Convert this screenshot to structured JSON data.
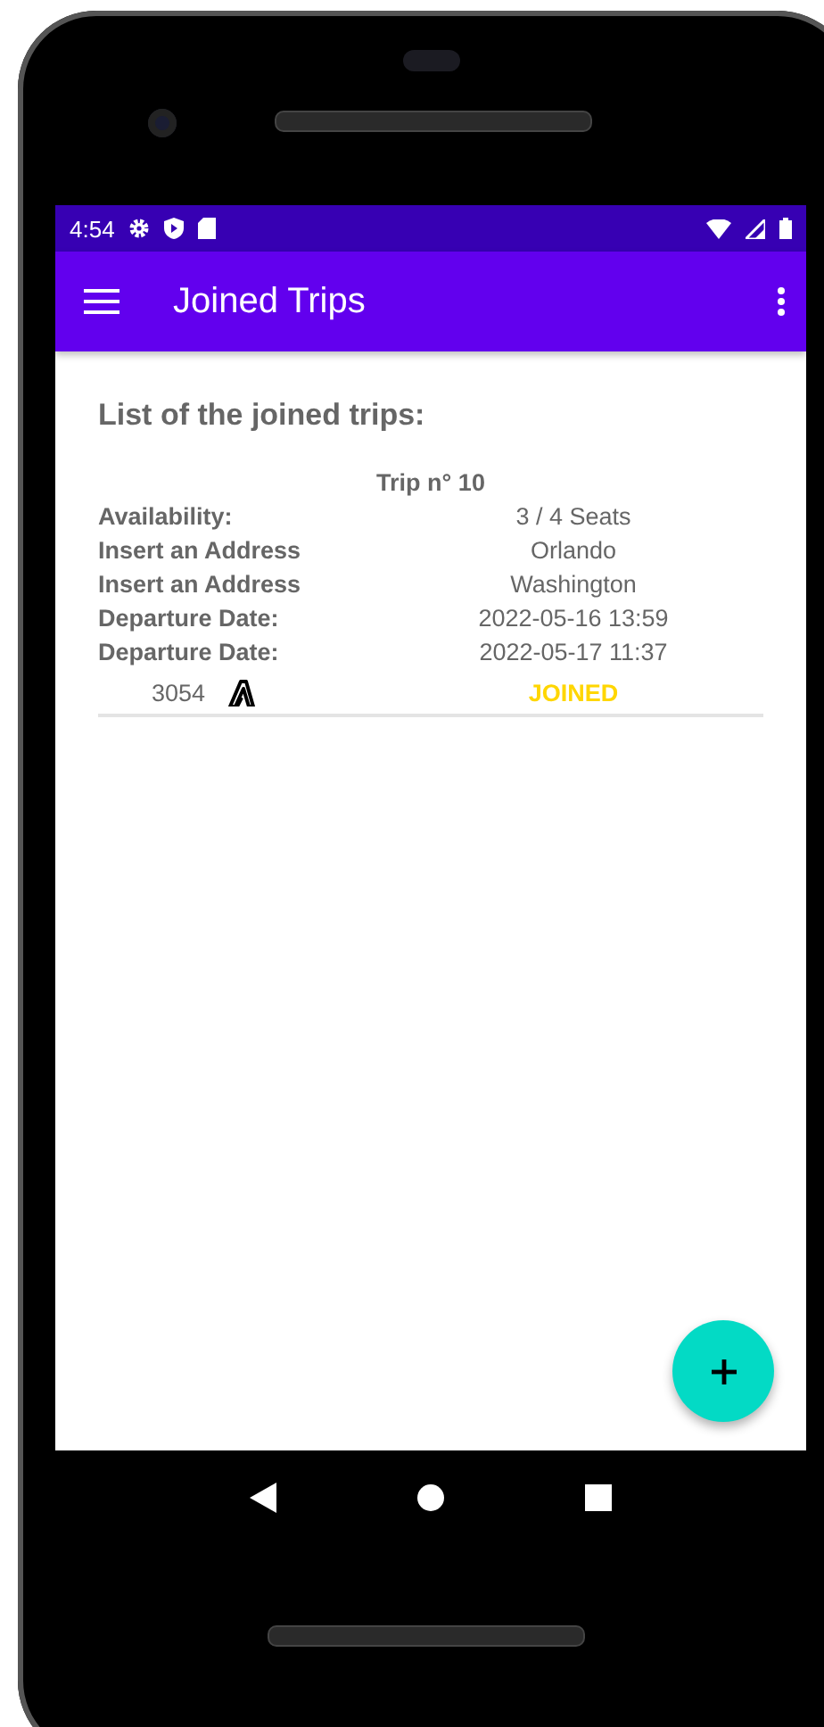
{
  "status_bar": {
    "time": "4:54"
  },
  "app_bar": {
    "title": "Joined Trips"
  },
  "heading": "List of the joined trips:",
  "trips": [
    {
      "title": "Trip n° 10",
      "rows": [
        {
          "label": "Availability:",
          "value": "3 / 4 Seats"
        },
        {
          "label": "Insert an Address",
          "value": "Orlando"
        },
        {
          "label": "Insert an Address",
          "value": "Washington"
        },
        {
          "label": "Departure Date:",
          "value": "2022-05-16 13:59"
        },
        {
          "label": "Departure Date:",
          "value": "2022-05-17 11:37"
        }
      ],
      "code": "3054",
      "status": "JOINED"
    }
  ]
}
